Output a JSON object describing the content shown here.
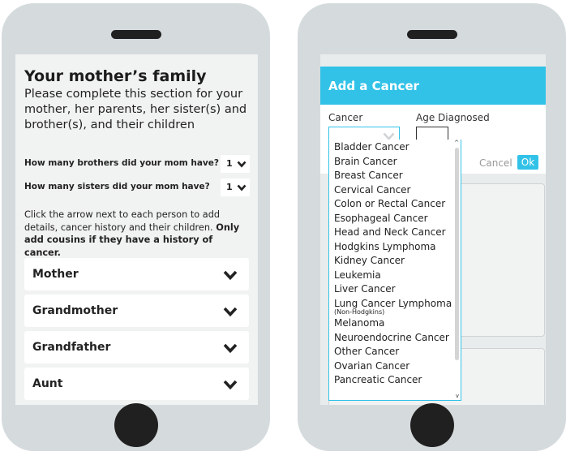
{
  "left": {
    "title": "Your mother’s family",
    "subtitle": "Please complete this section for your mother, her parents, her sister(s) and brother(s), and their children",
    "questions": [
      {
        "label": "How many brothers did your mom have?",
        "value": "1"
      },
      {
        "label": "How many sisters did your mom have?",
        "value": "1"
      }
    ],
    "instructions": {
      "normal": "Click the arrow next to each person to add details, cancer history and their children. ",
      "bold": "Only add cousins if they have a history of cancer."
    },
    "people": [
      "Mother",
      "Grandmother",
      "Grandfather",
      "Aunt"
    ]
  },
  "right": {
    "modal_title": "Add a Cancer",
    "cancer_label": "Cancer",
    "age_label": "Age Diagnosed",
    "cancel_label": "Cancel",
    "ok_label": "Ok",
    "options": [
      "Bladder Cancer",
      "Brain Cancer",
      "Breast Cancer",
      "Cervical Cancer",
      "Colon or Rectal Cancer",
      "Esophageal Cancer",
      "Head and Neck Cancer",
      "Hodgkins Lymphoma",
      "Kidney Cancer",
      "Leukemia",
      "Liver Cancer",
      "Lung Cancer Lymphoma",
      "Melanoma",
      "Neuroendocrine Cancer",
      "Other Cancer",
      "Ovarian Cancer",
      "Pancreatic Cancer"
    ],
    "option_note": "(Non-Hodgkins)"
  },
  "colors": {
    "accent": "#32c2e8",
    "phone_body": "#d5dbdd",
    "screen": "#f1f2f2"
  },
  "icons": {
    "select_arrow": "chevron-down-icon",
    "scroll_up": "scroll-up-arrow-icon",
    "scroll_down": "scroll-down-arrow-icon"
  }
}
